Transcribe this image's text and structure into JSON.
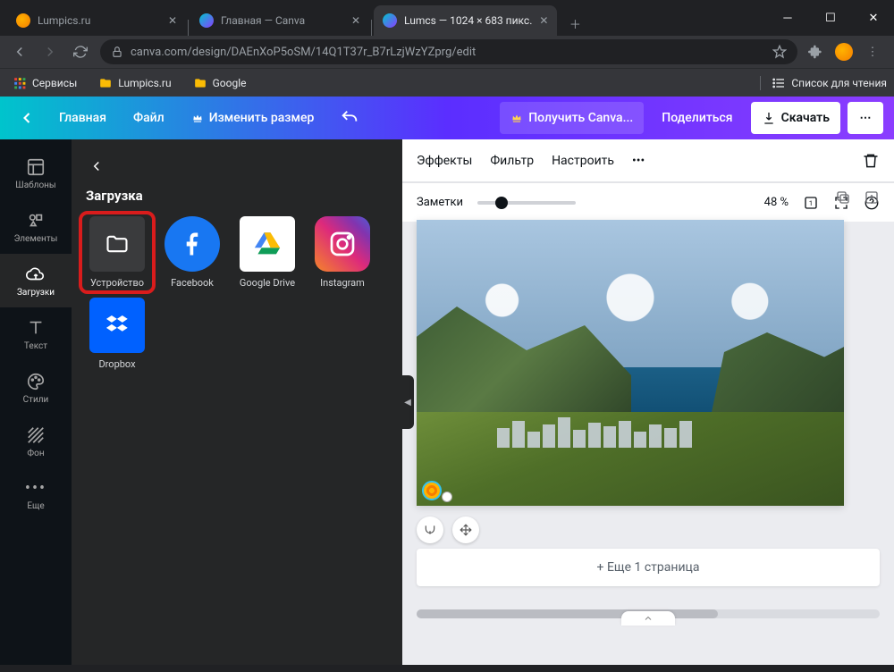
{
  "browser": {
    "tabs": [
      {
        "title": "Lumpics.ru",
        "active": false,
        "favicon": "orange"
      },
      {
        "title": "Главная — Canva",
        "active": false,
        "favicon": "canva"
      },
      {
        "title": "Lumcs — 1024 × 683 пикс.",
        "active": true,
        "favicon": "canva"
      }
    ],
    "url": "canva.com/design/DAEnXoP5oSM/14Q1T37r_B7rLzjWzYZprg/edit",
    "bookmarks": {
      "services": "Сервисы",
      "items": [
        "Lumpics.ru",
        "Google"
      ],
      "reading_list": "Список для чтения"
    }
  },
  "header": {
    "home": "Главная",
    "file": "Файл",
    "resize": "Изменить размер",
    "get_pro": "Получить Canva...",
    "share": "Поделиться",
    "download": "Скачать"
  },
  "rail": {
    "templates": "Шаблоны",
    "elements": "Элементы",
    "uploads": "Загрузки",
    "text": "Текст",
    "styles": "Стили",
    "background": "Фон",
    "more": "Еще"
  },
  "panel": {
    "title": "Загрузка",
    "sources": {
      "device": "Устройство",
      "facebook": "Facebook",
      "drive": "Google Drive",
      "instagram": "Instagram",
      "dropbox": "Dropbox"
    }
  },
  "canvas_toolbar": {
    "effects": "Эффекты",
    "filter": "Фильтр",
    "adjust": "Настроить"
  },
  "canvas": {
    "add_page": "+ Еще 1 страница"
  },
  "footer": {
    "notes": "Заметки",
    "zoom_pct": "48 %"
  }
}
